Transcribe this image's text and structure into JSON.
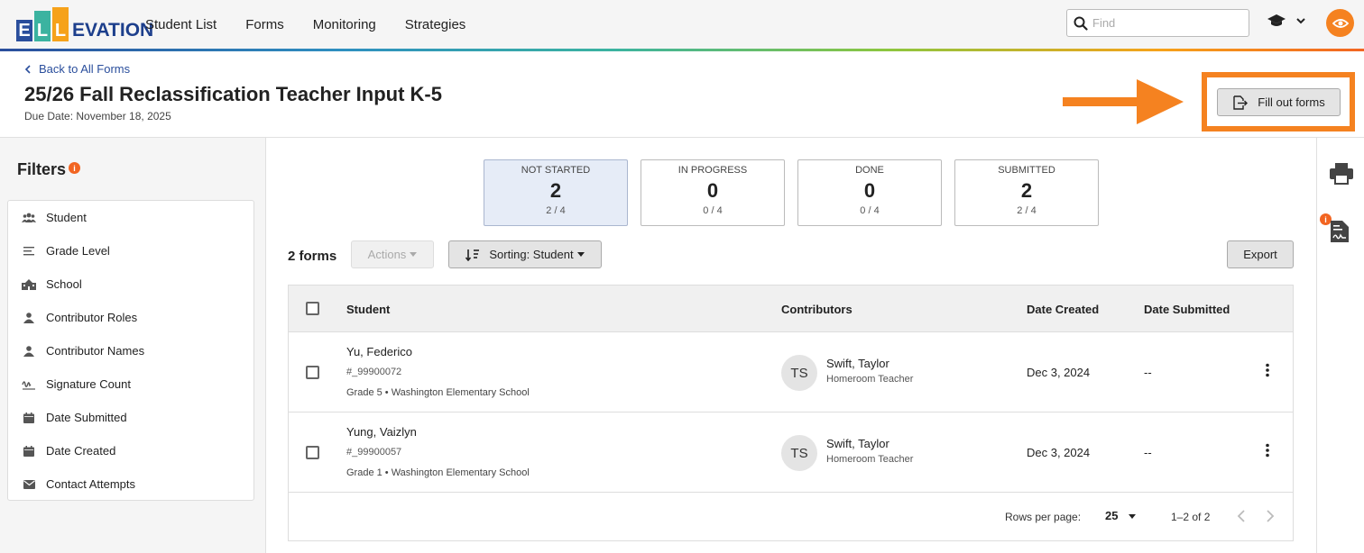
{
  "app": {
    "logo_letters": [
      "E",
      "L",
      "L"
    ],
    "logo_letter_colors": [
      "#2a4e9c",
      "#3bb3a0",
      "#f6a21a"
    ],
    "logo_word": "EVATION",
    "accent": "#f58220"
  },
  "nav": {
    "items": [
      "Student List",
      "Forms",
      "Monitoring",
      "Strategies"
    ]
  },
  "search": {
    "placeholder": "Find",
    "value": ""
  },
  "header": {
    "back_label": "Back to All Forms",
    "title": "25/26 Fall Reclassification Teacher Input K-5",
    "due_date": "Due Date: November 18, 2025",
    "fill_out_label": "Fill out forms"
  },
  "filters": {
    "title": "Filters",
    "items": [
      {
        "label": "Student",
        "icon": "users-icon"
      },
      {
        "label": "Grade Level",
        "icon": "lines-icon"
      },
      {
        "label": "School",
        "icon": "school-icon"
      },
      {
        "label": "Contributor Roles",
        "icon": "person-icon"
      },
      {
        "label": "Contributor Names",
        "icon": "person-icon"
      },
      {
        "label": "Signature Count",
        "icon": "signature-icon"
      },
      {
        "label": "Date Submitted",
        "icon": "calendar-icon"
      },
      {
        "label": "Date Created",
        "icon": "calendar-icon"
      },
      {
        "label": "Contact Attempts",
        "icon": "envelope-icon"
      }
    ]
  },
  "stats": [
    {
      "label": "NOT STARTED",
      "value": "2",
      "fraction": "2 / 4",
      "active": true
    },
    {
      "label": "IN PROGRESS",
      "value": "0",
      "fraction": "0 / 4",
      "active": false
    },
    {
      "label": "DONE",
      "value": "0",
      "fraction": "0 / 4",
      "active": false
    },
    {
      "label": "SUBMITTED",
      "value": "2",
      "fraction": "2 / 4",
      "active": false
    }
  ],
  "toolbar": {
    "count": "2 forms",
    "actions_label": "Actions",
    "sorting_label": "Sorting: Student",
    "export_label": "Export"
  },
  "table": {
    "columns": [
      "Student",
      "Contributors",
      "Date Created",
      "Date Submitted"
    ],
    "rows": [
      {
        "name": "Yu, Federico",
        "id": "#_99900072",
        "meta": "Grade 5 • Washington Elementary School",
        "initials": "TS",
        "contributor": "Swift, Taylor",
        "role": "Homeroom Teacher",
        "created": "Dec 3, 2024",
        "submitted": "--"
      },
      {
        "name": "Yung, Vaizlyn",
        "id": "#_99900057",
        "meta": "Grade 1 • Washington Elementary School",
        "initials": "TS",
        "contributor": "Swift, Taylor",
        "role": "Homeroom Teacher",
        "created": "Dec 3, 2024",
        "submitted": "--"
      }
    ],
    "rows_per_page_label": "Rows per page:",
    "rows_per_page": "25",
    "range": "1–2 of 2"
  }
}
